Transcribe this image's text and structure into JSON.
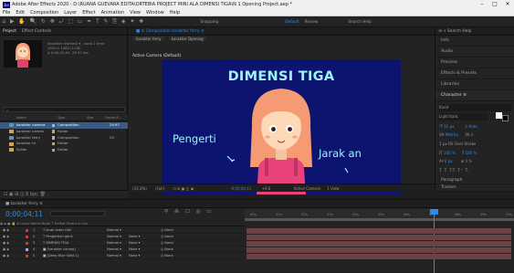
{
  "window": {
    "app_icon": "Ae",
    "title": "Adobe After Effects 2020 - D:\\RUANA GUEVARA EDITA\\ORTEBIA PROJECT MINI ALA DIMENSI TIGA\\N 1 Opening Project.aep *",
    "minimize": "–",
    "maximize": "□",
    "close": "✕"
  },
  "menu": [
    "File",
    "Edit",
    "Composition",
    "Layer",
    "Effect",
    "Animation",
    "View",
    "Window",
    "Help"
  ],
  "toolbar": {
    "icons": [
      "home-icon",
      "selection-tool-icon",
      "hand-tool-icon",
      "zoom-tool-icon",
      "orbit-tool-icon",
      "pan-behind-icon",
      "rotate-tool-icon",
      "camera-tool-icon",
      "rectangle-tool-icon",
      "pen-tool-icon",
      "type-tool-icon",
      "brush-tool-icon",
      "clone-stamp-icon",
      "eraser-tool-icon",
      "roto-brush-icon",
      "puppet-tool-icon"
    ],
    "glyphs": [
      "⌂",
      "▶",
      "✋",
      "🔍",
      "↻",
      "✥",
      "⤾",
      "⬚",
      "▭",
      "✒",
      "T",
      "✎",
      "⎘",
      "◈",
      "✦",
      "✚"
    ],
    "snapping_label": "Snapping",
    "default_label": "Default",
    "review_label": "Review",
    "search_placeholder": "Search Help"
  },
  "project": {
    "tabs": [
      "Project",
      "Effect Controls"
    ],
    "thumb_info": [
      "Karakter (cameo) ▾ , used 1 time",
      "1920 x 1080 (1.00)",
      "Δ 0;00;10;00, 29.97 fps"
    ],
    "search_placeholder": "⌕",
    "columns": [
      "Name",
      "Type",
      "Size",
      "Frame R..."
    ],
    "items": [
      {
        "name": "karakter camera",
        "type": "Composition",
        "size": "29.97",
        "color": "#b9a8c6",
        "selected": true,
        "folder": false
      },
      {
        "name": "karakter cameo",
        "type": "Folder",
        "size": "",
        "color": "#c9a55a",
        "selected": false,
        "folder": true
      },
      {
        "name": "karakter ferry",
        "type": "Composition",
        "size": "29",
        "color": "#b9a8c6",
        "selected": false,
        "folder": false
      },
      {
        "name": "karakter tri",
        "type": "Folder",
        "size": "",
        "color": "#c9a55a",
        "selected": false,
        "folder": true
      },
      {
        "name": "Solids",
        "type": "Folder",
        "size": "",
        "color": "#c9a55a",
        "selected": false,
        "folder": true
      }
    ],
    "bottom_bar": "⊡ ▣ ⊞ ◫   8 bpc   🗑"
  },
  "composition": {
    "tab_label": "■ ≡  Composition karakter ferry  ≡",
    "sub_tabs": [
      "karakter ferry",
      "karakter Opening"
    ],
    "active_camera": "Active Camera (Default)",
    "canvas_title": "DIMENSI TIGA",
    "canvas_left_text": "Pengerti",
    "canvas_right_text": "Jarak an",
    "bottom_zoom": "(33.3%)",
    "bottom_quality": "(Full)",
    "bottom_time": "0;00;04;11",
    "bottom_camera": "Active Camera",
    "bottom_view": "1 View",
    "bottom_extra": "+0.0"
  },
  "right_panels": {
    "header": "≫  ⌕  Search Help",
    "items": [
      "Info",
      "Audio",
      "Preview",
      "Effects & Presets",
      "Libraries"
    ],
    "character_title": "Character  ≡",
    "font_name": "Kanit",
    "font_style": "Light Italic",
    "size_a": "61 px",
    "size_b": "Auto",
    "tracking_a": "Metrics",
    "tracking_b": "0",
    "stroke": "1 px   Fill Over Stroke",
    "scale_a": "100 %",
    "scale_b": "100 %",
    "baseline_a": "0 px",
    "baseline_b": "0 %",
    "styles": "T  T  TT  Tᵀ  T,",
    "paragraph": "Paragraph",
    "tracker": "Tracker"
  },
  "timeline": {
    "tab_label": "■  karakter ferry  ≡",
    "current_time": "0;00;04;11",
    "tools": "⚲  ⁂  ☐  ◎  ▭",
    "ruler_labels": [
      "00s",
      "01s",
      "02s",
      "03s",
      "04s",
      "05s",
      "06s",
      "07s",
      "08s",
      "09s",
      "10s"
    ],
    "columns": "◉ ◈ ● 🔒 #   Layer Name            Mode       T  TrkMat      Parent & Link",
    "layers": [
      {
        "num": "1",
        "color": "#b0463c",
        "name": "T  Jarak antar titik",
        "mode": "Normal ▾",
        "trkmat": "",
        "parent": "◎ None"
      },
      {
        "num": "2",
        "color": "#b0463c",
        "name": "T  Pengertian garis",
        "mode": "Normal ▾",
        "trkmat": "None ▾",
        "parent": "◎ None"
      },
      {
        "num": "3",
        "color": "#b0463c",
        "name": "T  DIMENSI TIGA",
        "mode": "Normal ▾",
        "trkmat": "None ▾",
        "parent": "◎ None"
      },
      {
        "num": "4",
        "color": "#b9a8c6",
        "name": "■ [karakter cameo]",
        "mode": "Normal ▾",
        "trkmat": "None ▾",
        "parent": "◎ None"
      },
      {
        "num": "5",
        "color": "#b0463c",
        "name": "■ [Deep Blue Solid 1]",
        "mode": "Normal ▾",
        "trkmat": "None ▾",
        "parent": "◎ None"
      }
    ],
    "footer": "⊞ ◎ ⊕   Toggle Switches / Modes"
  }
}
